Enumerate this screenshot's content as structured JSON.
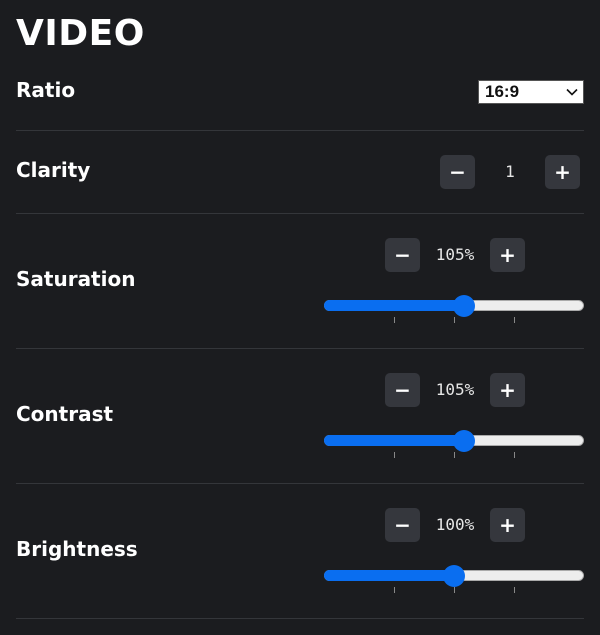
{
  "title": "VIDEO",
  "ratio": {
    "label": "Ratio",
    "selected": "16:9"
  },
  "clarity": {
    "label": "Clarity",
    "value": "1",
    "minus": "−",
    "plus": "+"
  },
  "sliders": [
    {
      "key": "saturation",
      "label": "Saturation",
      "display": "105%",
      "level": 0.54,
      "minus": "−",
      "plus": "+"
    },
    {
      "key": "contrast",
      "label": "Contrast",
      "display": "105%",
      "level": 0.54,
      "minus": "−",
      "plus": "+"
    },
    {
      "key": "brightness",
      "label": "Brightness",
      "display": "100%",
      "level": 0.5,
      "minus": "−",
      "plus": "+"
    }
  ],
  "colors": {
    "accent": "#0a6ef0",
    "background": "#1b1c1f",
    "button": "#35373d"
  }
}
